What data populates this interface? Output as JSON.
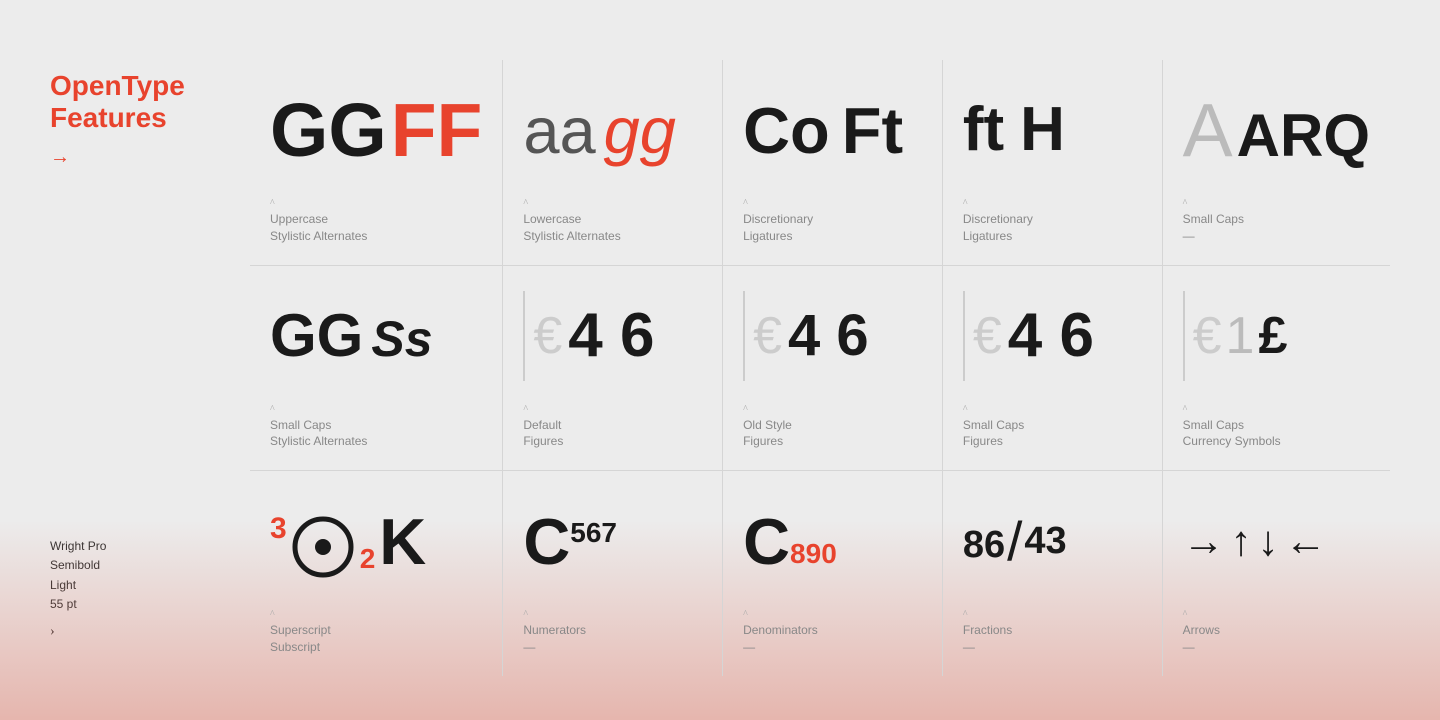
{
  "sidebar": {
    "title": "OpenType\nFeatures",
    "arrow": "→",
    "font_name": "Wright Pro",
    "font_style_1": "Semibold",
    "font_style_2": "Light",
    "font_size": "55 pt",
    "nav_arrow": "›"
  },
  "cells": [
    {
      "row": 1,
      "col": 1,
      "label_primary": "Uppercase",
      "label_secondary": "Stylistic Alternates",
      "label_dash": ""
    },
    {
      "row": 1,
      "col": 2,
      "label_primary": "Lowercase",
      "label_secondary": "Stylistic Alternates",
      "label_dash": ""
    },
    {
      "row": 1,
      "col": 3,
      "label_primary": "Discretionary",
      "label_secondary": "Ligatures",
      "label_dash": ""
    },
    {
      "row": 1,
      "col": 4,
      "label_primary": "Discretionary",
      "label_secondary": "Ligatures",
      "label_dash": ""
    },
    {
      "row": 1,
      "col": 5,
      "label_primary": "Small Caps",
      "label_secondary": "—",
      "label_dash": ""
    },
    {
      "row": 2,
      "col": 1,
      "label_primary": "Small Caps",
      "label_secondary": "Stylistic Alternates",
      "label_dash": ""
    },
    {
      "row": 2,
      "col": 2,
      "label_primary": "Default",
      "label_secondary": "Figures",
      "label_dash": ""
    },
    {
      "row": 2,
      "col": 3,
      "label_primary": "Old Style",
      "label_secondary": "Figures",
      "label_dash": ""
    },
    {
      "row": 2,
      "col": 4,
      "label_primary": "Small Caps",
      "label_secondary": "Figures",
      "label_dash": ""
    },
    {
      "row": 2,
      "col": 5,
      "label_primary": "Small Caps",
      "label_secondary": "Currency Symbols",
      "label_dash": ""
    },
    {
      "row": 3,
      "col": 1,
      "label_primary": "Superscript",
      "label_secondary": "Subscript",
      "label_dash": ""
    },
    {
      "row": 3,
      "col": 2,
      "label_primary": "Numerators",
      "label_secondary": "—",
      "label_dash": ""
    },
    {
      "row": 3,
      "col": 3,
      "label_primary": "Denominators",
      "label_secondary": "—",
      "label_dash": ""
    },
    {
      "row": 3,
      "col": 4,
      "label_primary": "Fractions",
      "label_secondary": "—",
      "label_dash": ""
    },
    {
      "row": 3,
      "col": 5,
      "label_primary": "Arrows",
      "label_secondary": "—",
      "label_dash": ""
    }
  ]
}
